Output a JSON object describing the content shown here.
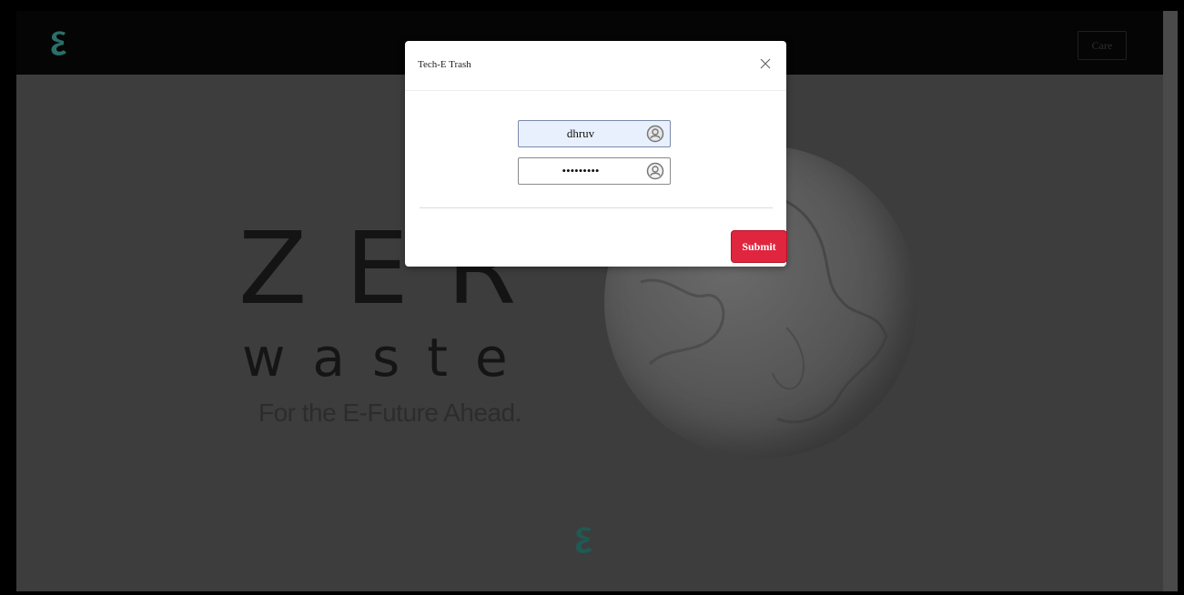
{
  "navbar": {
    "logo_icon": "e-logo-icon",
    "button_label": "Care"
  },
  "hero": {
    "line1": "ZER",
    "line2": "waste",
    "tagline": "For the E-Future Ahead."
  },
  "modal": {
    "title": "Tech-E Trash",
    "close_icon": "close-icon",
    "username": {
      "value": "dhruv",
      "icon": "user-avatar-icon"
    },
    "password": {
      "value": "•••••••••",
      "icon": "user-avatar-icon"
    },
    "submit_label": "Submit"
  },
  "colors": {
    "accent": "#e0253e",
    "logo": "#2a6f68",
    "autofill_bg": "#e8f0fe"
  }
}
